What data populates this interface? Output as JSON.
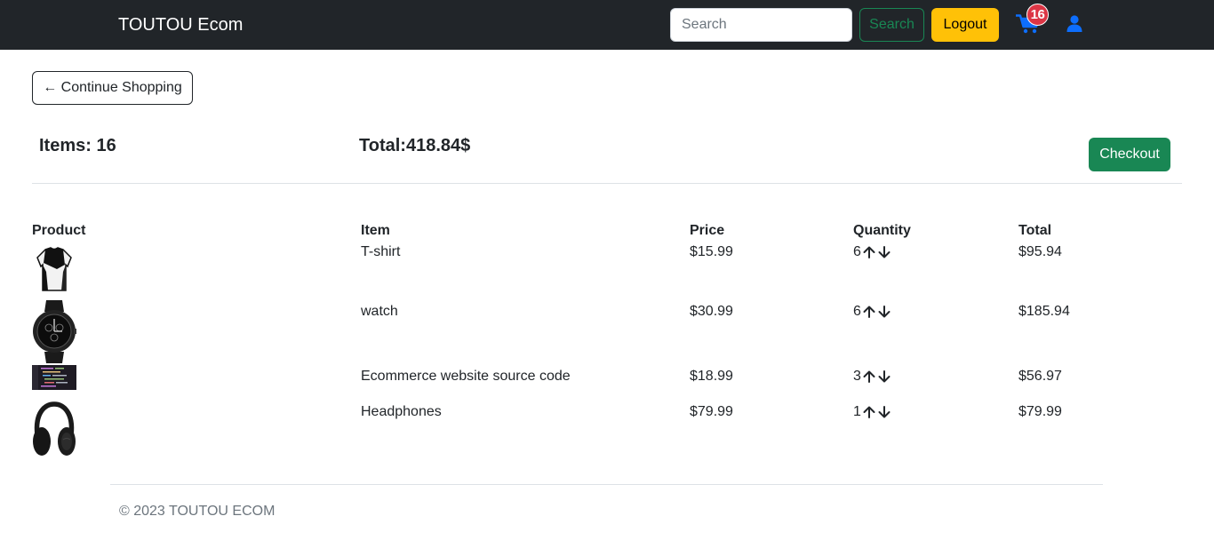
{
  "navbar": {
    "brand": "TOUTOU Ecom",
    "search_placeholder": "Search",
    "search_value": "",
    "search_button": "Search",
    "logout_button": "Logout",
    "cart_count": "16",
    "cart_icon": "shopping-cart-icon",
    "user_icon": "user-icon"
  },
  "actions": {
    "continue_shopping": "← Continue Shopping",
    "checkout": "Checkout"
  },
  "summary": {
    "items_label": "Items: ",
    "items_value": "16",
    "total_label": "Total:",
    "total_value": "418.84$"
  },
  "table": {
    "headers": {
      "product": "Product",
      "item": "Item",
      "price": "Price",
      "quantity": "Quantity",
      "total": "Total"
    },
    "rows": [
      {
        "image": "t-shirt-image",
        "item": "T-shirt",
        "price": "$15.99",
        "quantity": "6",
        "total": "$95.94"
      },
      {
        "image": "watch-image",
        "item": "watch",
        "price": "$30.99",
        "quantity": "6",
        "total": "$185.94"
      },
      {
        "image": "source-code-image",
        "item": "Ecommerce website source code",
        "price": "$18.99",
        "quantity": "3",
        "total": "$56.97"
      },
      {
        "image": "headphones-image",
        "item": "Headphones",
        "price": "$79.99",
        "quantity": "1",
        "total": "$79.99"
      }
    ]
  },
  "footer": {
    "text": "© 2023 TOUTOU ECOM"
  },
  "colors": {
    "navbar_bg": "#212529",
    "success": "#198754",
    "warning": "#ffc107",
    "danger": "#dc3545",
    "primary": "#0d6efd",
    "muted": "#6c757d"
  }
}
